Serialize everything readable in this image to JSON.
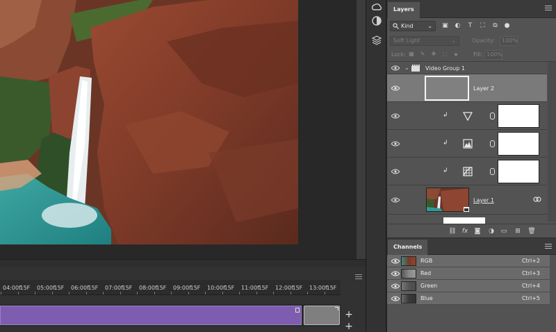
{
  "layers_panel": {
    "tab": "Layers",
    "filter_kind": "Kind",
    "blend_mode": "Soft Light",
    "opacity_label": "Opacity:",
    "opacity_value": "100%",
    "lock_label": "Lock:",
    "fill_label": "Fill:",
    "fill_value": "100%",
    "group_name": "Video Group 1",
    "layer2_name": "Layer 2",
    "layer1_name": "Layer 1",
    "adjustment_icons": [
      "triangle-down-icon",
      "levels-icon",
      "curves-icon"
    ],
    "footer_icons": [
      "link-icon",
      "fx-icon",
      "mask-icon",
      "adjustment-icon",
      "folder-icon",
      "new-layer-icon",
      "trash-icon"
    ]
  },
  "channels_panel": {
    "tab": "Channels",
    "channels": [
      {
        "name": "RGB",
        "shortcut": "Ctrl+2"
      },
      {
        "name": "Red",
        "shortcut": "Ctrl+3"
      },
      {
        "name": "Green",
        "shortcut": "Ctrl+4"
      },
      {
        "name": "Blue",
        "shortcut": "Ctrl+5"
      }
    ]
  },
  "timeline": {
    "ruler_labels": [
      "04:00f",
      "15F",
      "05:00f",
      "15F",
      "06:00f",
      "15F",
      "07:00f",
      "15F",
      "08:00f",
      "15F",
      "09:00f",
      "15F",
      "10:00f",
      "15F",
      "11:00f",
      "15F",
      "12:00f",
      "15F",
      "13:00f",
      "15F"
    ]
  },
  "colors": {
    "clip_purple": "#7e5cb0",
    "panel_bg": "#535353",
    "selected_layer": "#7a7a7a"
  }
}
